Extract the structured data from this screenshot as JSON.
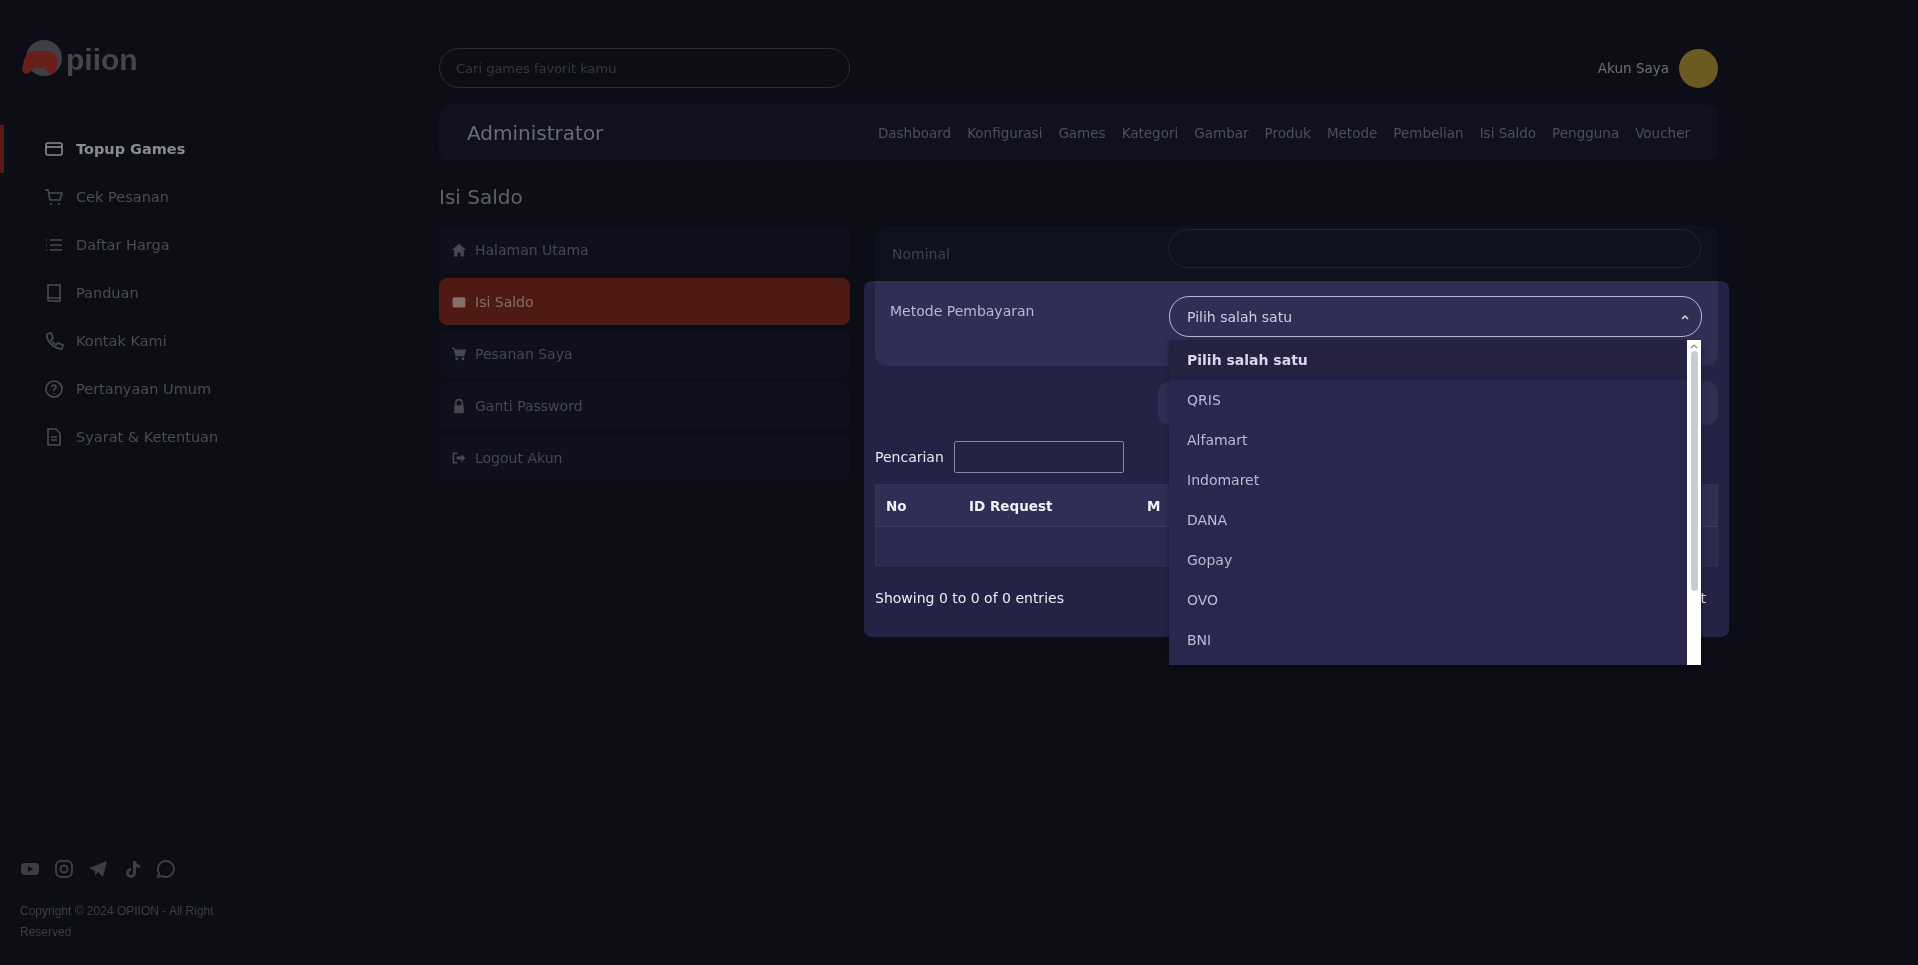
{
  "logo": {
    "text": "piion"
  },
  "sidebar": {
    "items": [
      {
        "label": "Topup Games",
        "selected": true
      },
      {
        "label": "Cek Pesanan",
        "selected": false
      },
      {
        "label": "Daftar Harga",
        "selected": false
      },
      {
        "label": "Panduan",
        "selected": false
      },
      {
        "label": "Kontak Kami",
        "selected": false
      },
      {
        "label": "Pertanyaan Umum",
        "selected": false
      },
      {
        "label": "Syarat & Ketentuan",
        "selected": false
      }
    ],
    "copyright": "Copyright © 2024 OPIION - All Right Reserved"
  },
  "search": {
    "placeholder": "Cari games favorit kamu"
  },
  "account": {
    "label": "Akun Saya"
  },
  "admin_bar": {
    "title": "Administrator",
    "nav": [
      "Dashboard",
      "Konfigurasi",
      "Games",
      "Kategori",
      "Gambar",
      "Produk",
      "Metode",
      "Pembelian",
      "Isi Saldo",
      "Pengguna",
      "Voucher"
    ]
  },
  "page_title": "Isi Saldo",
  "account_menu": [
    {
      "label": "Halaman Utama",
      "selected": false
    },
    {
      "label": "Isi Saldo",
      "selected": true
    },
    {
      "label": "Pesanan Saya",
      "selected": false
    },
    {
      "label": "Ganti Password",
      "selected": false
    },
    {
      "label": "Logout Akun",
      "selected": false
    }
  ],
  "form": {
    "nominal_label": "Nominal",
    "method_label": "Metode Pembayaran",
    "method_value": "Pilih salah satu",
    "options": [
      {
        "label": "Pilih salah satu",
        "selected": true
      },
      {
        "label": "QRIS",
        "selected": false
      },
      {
        "label": "Alfamart",
        "selected": false
      },
      {
        "label": "Indomaret",
        "selected": false
      },
      {
        "label": "DANA",
        "selected": false
      },
      {
        "label": "Gopay",
        "selected": false
      },
      {
        "label": "OVO",
        "selected": false
      },
      {
        "label": "BNI",
        "selected": false
      }
    ]
  },
  "table": {
    "search_label": "Pencarian",
    "columns": [
      "No",
      "ID Request",
      "M"
    ],
    "info": "Showing 0 to 0 of 0 entries",
    "pagination_fragment": "t"
  }
}
